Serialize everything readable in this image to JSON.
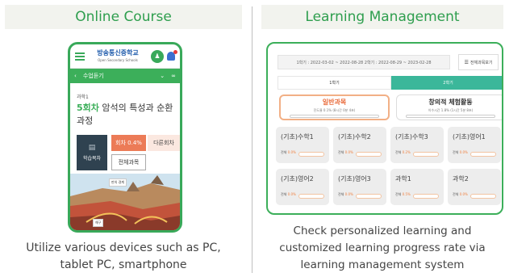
{
  "left": {
    "header": "Online Course",
    "caption_lines": [
      "Utilize various devices such as PC,",
      "tablet PC, smartphone"
    ],
    "phone": {
      "logo": "방송통신중학교",
      "logo_sub": "Open Secondary Schools",
      "nav_label": "수업듣기",
      "subject": "과학1",
      "episode": "5회차",
      "lesson_title": "암석의 특성과 순환 과정",
      "study_label": "학습목차",
      "episode_rate": "회차 0.4%",
      "other_episode": "다른회차",
      "all_courses": "전체과목",
      "illus_chip_1": "판의 경계",
      "illus_chip_2": "해구"
    }
  },
  "right": {
    "header": "Learning Management",
    "caption_lines": [
      "Check personalized learning and",
      "customized learning progress rate via",
      "learning management system"
    ],
    "semester_dates": "1학기 : 2022-03-02 ~ 2022-08-28   2학기 : 2022-08-29 ~ 2023-02-28",
    "view_all_label": "전체과목보기",
    "tabs": [
      "1학기",
      "2학기"
    ],
    "categories": [
      {
        "name": "일반과목",
        "status": "진도율 0.1% (8시간 0분 4초)"
      },
      {
        "name": "창의적 체험활동",
        "status": "이수시간 1.8% (1시간 5분 8초)"
      }
    ],
    "total_label": "전체",
    "courses": [
      {
        "name": "(기초)수학1",
        "rate": "0.0%"
      },
      {
        "name": "(기초)수학2",
        "rate": "0.0%"
      },
      {
        "name": "(기초)수학3",
        "rate": "0.2%"
      },
      {
        "name": "(기초)영어1",
        "rate": "0.0%"
      },
      {
        "name": "(기초)영어2",
        "rate": "0.0%"
      },
      {
        "name": "(기초)영어3",
        "rate": "0.0%"
      },
      {
        "name": "과학1",
        "rate": "0.5%"
      },
      {
        "name": "과학2",
        "rate": "0.0%"
      }
    ]
  }
}
